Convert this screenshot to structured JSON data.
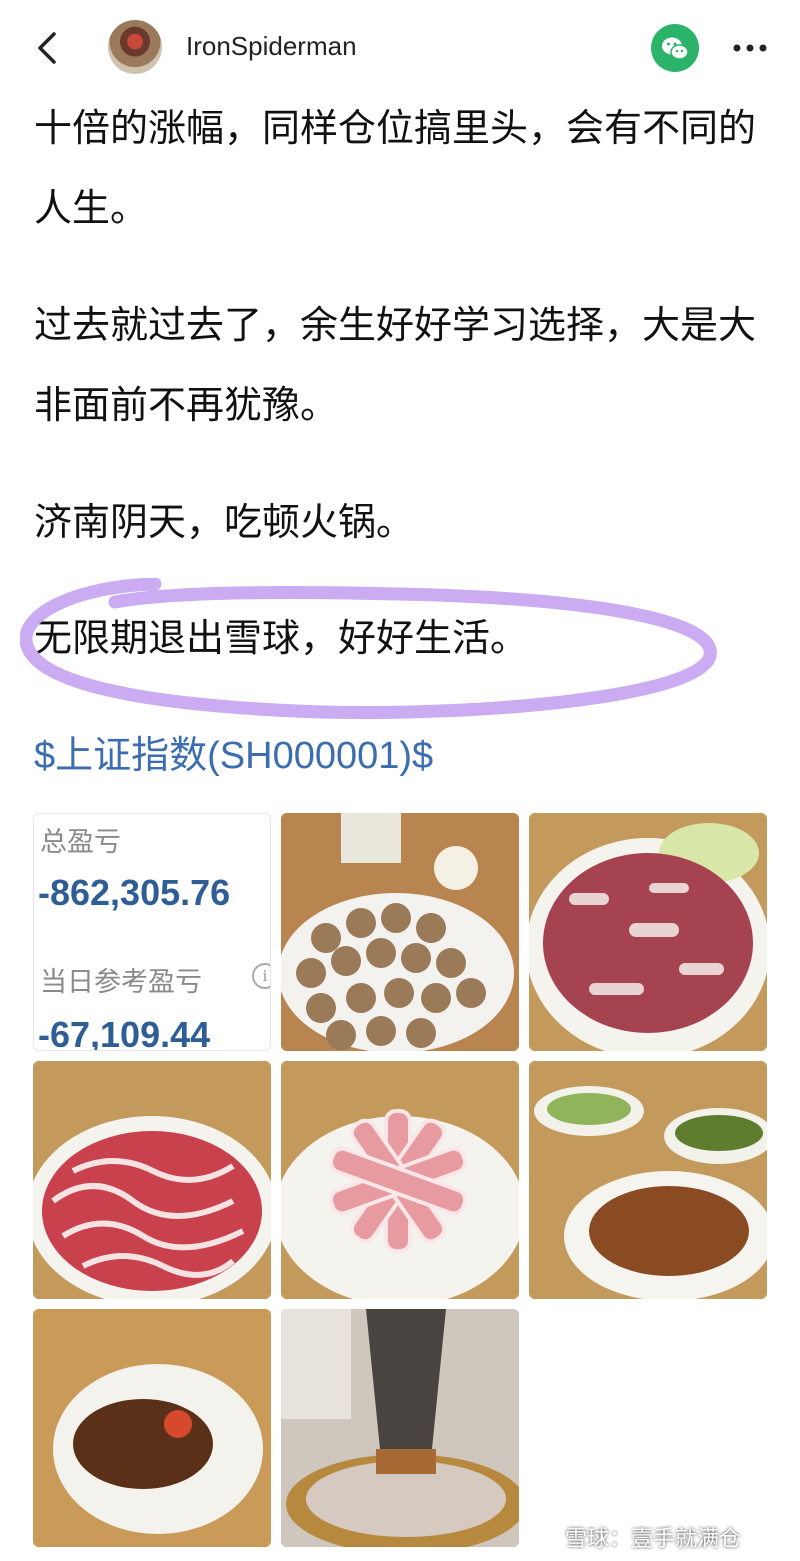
{
  "header": {
    "username": "IronSpiderman",
    "icons": [
      "back-arrow-icon",
      "avatar",
      "wechat-icon",
      "more-icon"
    ],
    "wechat_color": "#2bb36a"
  },
  "post": {
    "paragraphs": [
      "十倍的涨幅，同样仓位搞里头，会有不同的人生。",
      "过去就过去了，余生好好学习选择，大是大非面前不再犹豫。",
      "济南阴天，吃顿火锅。",
      "无限期退出雪球，好好生活。"
    ],
    "highlight_color": "#c8a7f0",
    "stock_tag": "$上证指数(SH000001)$",
    "link_color": "#3b6db0"
  },
  "screenshot": {
    "total_label": "总盈亏",
    "total_value": "-862,305.76",
    "daily_label": "当日参考盈亏",
    "daily_value": "-67,109.44",
    "info_icon": "i"
  },
  "watermark": {
    "logo": "雪球-logo-icon",
    "text": "雪球：壹手就满仓"
  }
}
